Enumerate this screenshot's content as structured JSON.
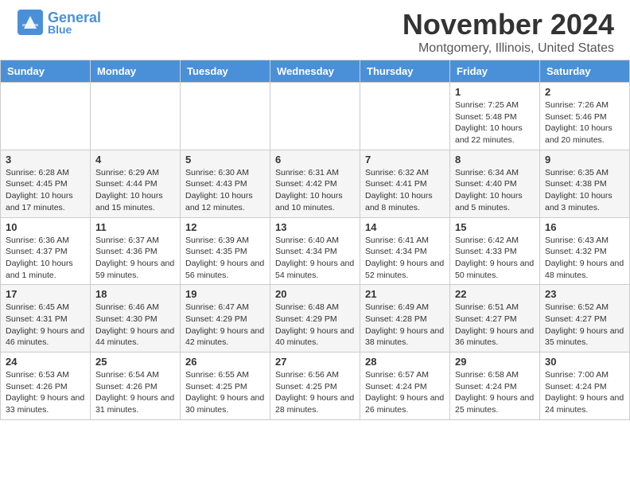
{
  "header": {
    "logo_general": "General",
    "logo_blue": "Blue",
    "month_title": "November 2024",
    "location": "Montgomery, Illinois, United States"
  },
  "weekdays": [
    "Sunday",
    "Monday",
    "Tuesday",
    "Wednesday",
    "Thursday",
    "Friday",
    "Saturday"
  ],
  "weeks": [
    [
      {
        "day": "",
        "info": ""
      },
      {
        "day": "",
        "info": ""
      },
      {
        "day": "",
        "info": ""
      },
      {
        "day": "",
        "info": ""
      },
      {
        "day": "",
        "info": ""
      },
      {
        "day": "1",
        "info": "Sunrise: 7:25 AM\nSunset: 5:48 PM\nDaylight: 10 hours and 22 minutes."
      },
      {
        "day": "2",
        "info": "Sunrise: 7:26 AM\nSunset: 5:46 PM\nDaylight: 10 hours and 20 minutes."
      }
    ],
    [
      {
        "day": "3",
        "info": "Sunrise: 6:28 AM\nSunset: 4:45 PM\nDaylight: 10 hours and 17 minutes."
      },
      {
        "day": "4",
        "info": "Sunrise: 6:29 AM\nSunset: 4:44 PM\nDaylight: 10 hours and 15 minutes."
      },
      {
        "day": "5",
        "info": "Sunrise: 6:30 AM\nSunset: 4:43 PM\nDaylight: 10 hours and 12 minutes."
      },
      {
        "day": "6",
        "info": "Sunrise: 6:31 AM\nSunset: 4:42 PM\nDaylight: 10 hours and 10 minutes."
      },
      {
        "day": "7",
        "info": "Sunrise: 6:32 AM\nSunset: 4:41 PM\nDaylight: 10 hours and 8 minutes."
      },
      {
        "day": "8",
        "info": "Sunrise: 6:34 AM\nSunset: 4:40 PM\nDaylight: 10 hours and 5 minutes."
      },
      {
        "day": "9",
        "info": "Sunrise: 6:35 AM\nSunset: 4:38 PM\nDaylight: 10 hours and 3 minutes."
      }
    ],
    [
      {
        "day": "10",
        "info": "Sunrise: 6:36 AM\nSunset: 4:37 PM\nDaylight: 10 hours and 1 minute."
      },
      {
        "day": "11",
        "info": "Sunrise: 6:37 AM\nSunset: 4:36 PM\nDaylight: 9 hours and 59 minutes."
      },
      {
        "day": "12",
        "info": "Sunrise: 6:39 AM\nSunset: 4:35 PM\nDaylight: 9 hours and 56 minutes."
      },
      {
        "day": "13",
        "info": "Sunrise: 6:40 AM\nSunset: 4:34 PM\nDaylight: 9 hours and 54 minutes."
      },
      {
        "day": "14",
        "info": "Sunrise: 6:41 AM\nSunset: 4:34 PM\nDaylight: 9 hours and 52 minutes."
      },
      {
        "day": "15",
        "info": "Sunrise: 6:42 AM\nSunset: 4:33 PM\nDaylight: 9 hours and 50 minutes."
      },
      {
        "day": "16",
        "info": "Sunrise: 6:43 AM\nSunset: 4:32 PM\nDaylight: 9 hours and 48 minutes."
      }
    ],
    [
      {
        "day": "17",
        "info": "Sunrise: 6:45 AM\nSunset: 4:31 PM\nDaylight: 9 hours and 46 minutes."
      },
      {
        "day": "18",
        "info": "Sunrise: 6:46 AM\nSunset: 4:30 PM\nDaylight: 9 hours and 44 minutes."
      },
      {
        "day": "19",
        "info": "Sunrise: 6:47 AM\nSunset: 4:29 PM\nDaylight: 9 hours and 42 minutes."
      },
      {
        "day": "20",
        "info": "Sunrise: 6:48 AM\nSunset: 4:29 PM\nDaylight: 9 hours and 40 minutes."
      },
      {
        "day": "21",
        "info": "Sunrise: 6:49 AM\nSunset: 4:28 PM\nDaylight: 9 hours and 38 minutes."
      },
      {
        "day": "22",
        "info": "Sunrise: 6:51 AM\nSunset: 4:27 PM\nDaylight: 9 hours and 36 minutes."
      },
      {
        "day": "23",
        "info": "Sunrise: 6:52 AM\nSunset: 4:27 PM\nDaylight: 9 hours and 35 minutes."
      }
    ],
    [
      {
        "day": "24",
        "info": "Sunrise: 6:53 AM\nSunset: 4:26 PM\nDaylight: 9 hours and 33 minutes."
      },
      {
        "day": "25",
        "info": "Sunrise: 6:54 AM\nSunset: 4:26 PM\nDaylight: 9 hours and 31 minutes."
      },
      {
        "day": "26",
        "info": "Sunrise: 6:55 AM\nSunset: 4:25 PM\nDaylight: 9 hours and 30 minutes."
      },
      {
        "day": "27",
        "info": "Sunrise: 6:56 AM\nSunset: 4:25 PM\nDaylight: 9 hours and 28 minutes."
      },
      {
        "day": "28",
        "info": "Sunrise: 6:57 AM\nSunset: 4:24 PM\nDaylight: 9 hours and 26 minutes."
      },
      {
        "day": "29",
        "info": "Sunrise: 6:58 AM\nSunset: 4:24 PM\nDaylight: 9 hours and 25 minutes."
      },
      {
        "day": "30",
        "info": "Sunrise: 7:00 AM\nSunset: 4:24 PM\nDaylight: 9 hours and 24 minutes."
      }
    ]
  ]
}
